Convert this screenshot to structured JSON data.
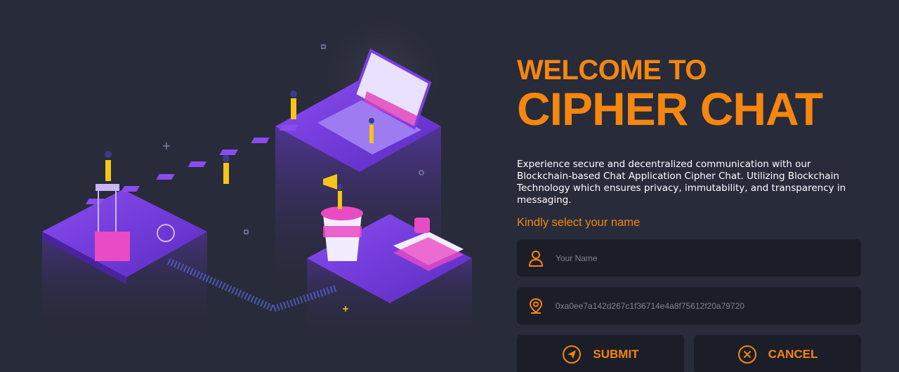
{
  "theme": {
    "accent": "#f5860f",
    "background": "#282b39",
    "field_bg": "#1b1d29",
    "purple": "#7b3fe4"
  },
  "hero": {
    "illustration": "isometric-blockchain-chat-illustration"
  },
  "heading": {
    "line1": "WELCOME TO",
    "line2": "CIPHER CHAT"
  },
  "description": "Experience secure and decentralized communication with our Blockchain-based Chat Application Cipher Chat. Utilizing Blockchain Technology which ensures privacy, immutability, and transparency in messaging.",
  "prompt": "Kindly select your name",
  "form": {
    "name": {
      "placeholder": "Your Name",
      "value": "",
      "icon": "user-icon"
    },
    "address": {
      "placeholder": "0xa0ee7a142d267c1f36714e4a8f75612f20a79720",
      "value": "",
      "icon": "location-pin-icon"
    }
  },
  "buttons": {
    "submit": {
      "label": "SUBMIT",
      "icon": "send-icon"
    },
    "cancel": {
      "label": "CANCEL",
      "icon": "close-circle-icon"
    }
  }
}
